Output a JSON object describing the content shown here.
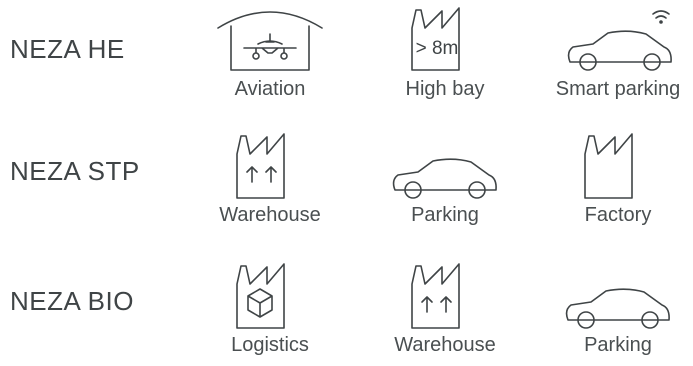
{
  "rows": [
    {
      "label": "NEZA HE",
      "items": [
        {
          "label": "Aviation",
          "icon": "airplane-hangar-icon"
        },
        {
          "label": "High bay",
          "icon": "factory-height-icon",
          "badge": "> 8m"
        },
        {
          "label": "Smart parking",
          "icon": "car-wifi-icon"
        }
      ]
    },
    {
      "label": "NEZA STP",
      "items": [
        {
          "label": "Warehouse",
          "icon": "factory-arrows-icon"
        },
        {
          "label": "Parking",
          "icon": "car-icon"
        },
        {
          "label": "Factory",
          "icon": "factory-icon"
        }
      ]
    },
    {
      "label": "NEZA BIO",
      "items": [
        {
          "label": "Logistics",
          "icon": "factory-box-icon"
        },
        {
          "label": "Warehouse",
          "icon": "factory-arrows-icon"
        },
        {
          "label": "Parking",
          "icon": "car-icon"
        }
      ]
    }
  ]
}
